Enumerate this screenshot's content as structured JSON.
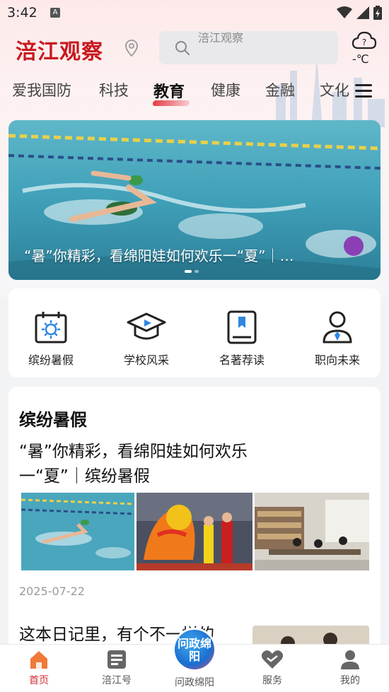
{
  "status": {
    "time": "3:42",
    "notif": "A"
  },
  "header": {
    "logo": "涪江观察",
    "search_placeholder": "涪江观察",
    "weather_temp": "-℃",
    "weather_icon": "cloud-question-icon"
  },
  "tabs": [
    {
      "label": "爱我国防"
    },
    {
      "label": "科技"
    },
    {
      "label": "教育"
    },
    {
      "label": "健康"
    },
    {
      "label": "金融"
    },
    {
      "label": "文化"
    }
  ],
  "banner": {
    "caption": "“暑”你精彩，看绵阳娃如何欢乐一“夏”｜…"
  },
  "quick_links": [
    {
      "label": "缤纷暑假",
      "icon": "calendar-sun-icon"
    },
    {
      "label": "学校风采",
      "icon": "graduation-cap-icon"
    },
    {
      "label": "名著荐读",
      "icon": "book-bookmark-icon"
    },
    {
      "label": "职向未来",
      "icon": "person-tie-icon"
    }
  ],
  "section": {
    "title": "缤纷暑假",
    "article1": {
      "title": "“暑”你精彩，看绵阳娃如何欢乐一“夏”｜缤纷暑假",
      "date": "2025-07-22"
    },
    "article2": {
      "title": "这本日记里，有个不一样的"
    }
  },
  "bottom_nav": [
    {
      "label": "首页",
      "icon": "home-icon"
    },
    {
      "label": "涪江号",
      "icon": "grid-card-icon"
    },
    {
      "label": "问政绵阳",
      "icon": "wenzheng-badge"
    },
    {
      "label": "服务",
      "icon": "heart-icon"
    },
    {
      "label": "我的",
      "icon": "user-icon"
    }
  ],
  "center_badge_text": "问政绵阳",
  "colors": {
    "brand_red": "#c8191f",
    "active_red": "#d52b34",
    "search_bg": "#e9e9ec"
  }
}
